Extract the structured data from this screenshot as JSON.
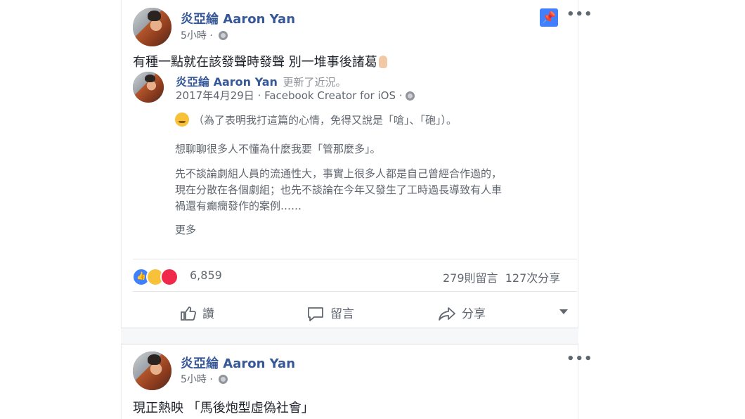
{
  "post1": {
    "author": "炎亞綸 Aaron Yan",
    "time": "5小時",
    "text": "有種一點就在該發聲時發聲 別一堆事後諸葛",
    "shared": {
      "author": "炎亞綸 Aaron Yan",
      "updated": "更新了近況。",
      "meta": "2017年4月29日 · Facebook Creator for iOS ·",
      "line1": "（為了表明我打這篇的心情，免得又說是「嗆」、「砲」）。",
      "line2": "想聊聊很多人不懂為什麼我要「管那麼多」。",
      "para": [
        "先不談論劇組人員的流通性大，事實上很多人都是自己曾經合作過的，",
        "現在分散在各個劇組；也先不談論在今年又發生了工時過長導致有人車",
        "禍還有癲癇發作的案例……"
      ],
      "more": "更多"
    },
    "reactions_count": "6,859",
    "comments": "279則留言",
    "shares": "127次分享",
    "actions": {
      "like": "讚",
      "comment": "留言",
      "share": "分享"
    }
  },
  "post2": {
    "author": "炎亞綸 Aaron Yan",
    "time": "5小時",
    "text": "現正熱映 「馬後炮型虛偽社會」"
  },
  "icons": [
    "pin-icon",
    "more-options-icon",
    "globe-icon",
    "like-icon",
    "comment-icon",
    "share-icon",
    "caret-down-icon"
  ],
  "colors": {
    "link": "#365899",
    "pin": "#4080ff",
    "meta": "#616770"
  }
}
